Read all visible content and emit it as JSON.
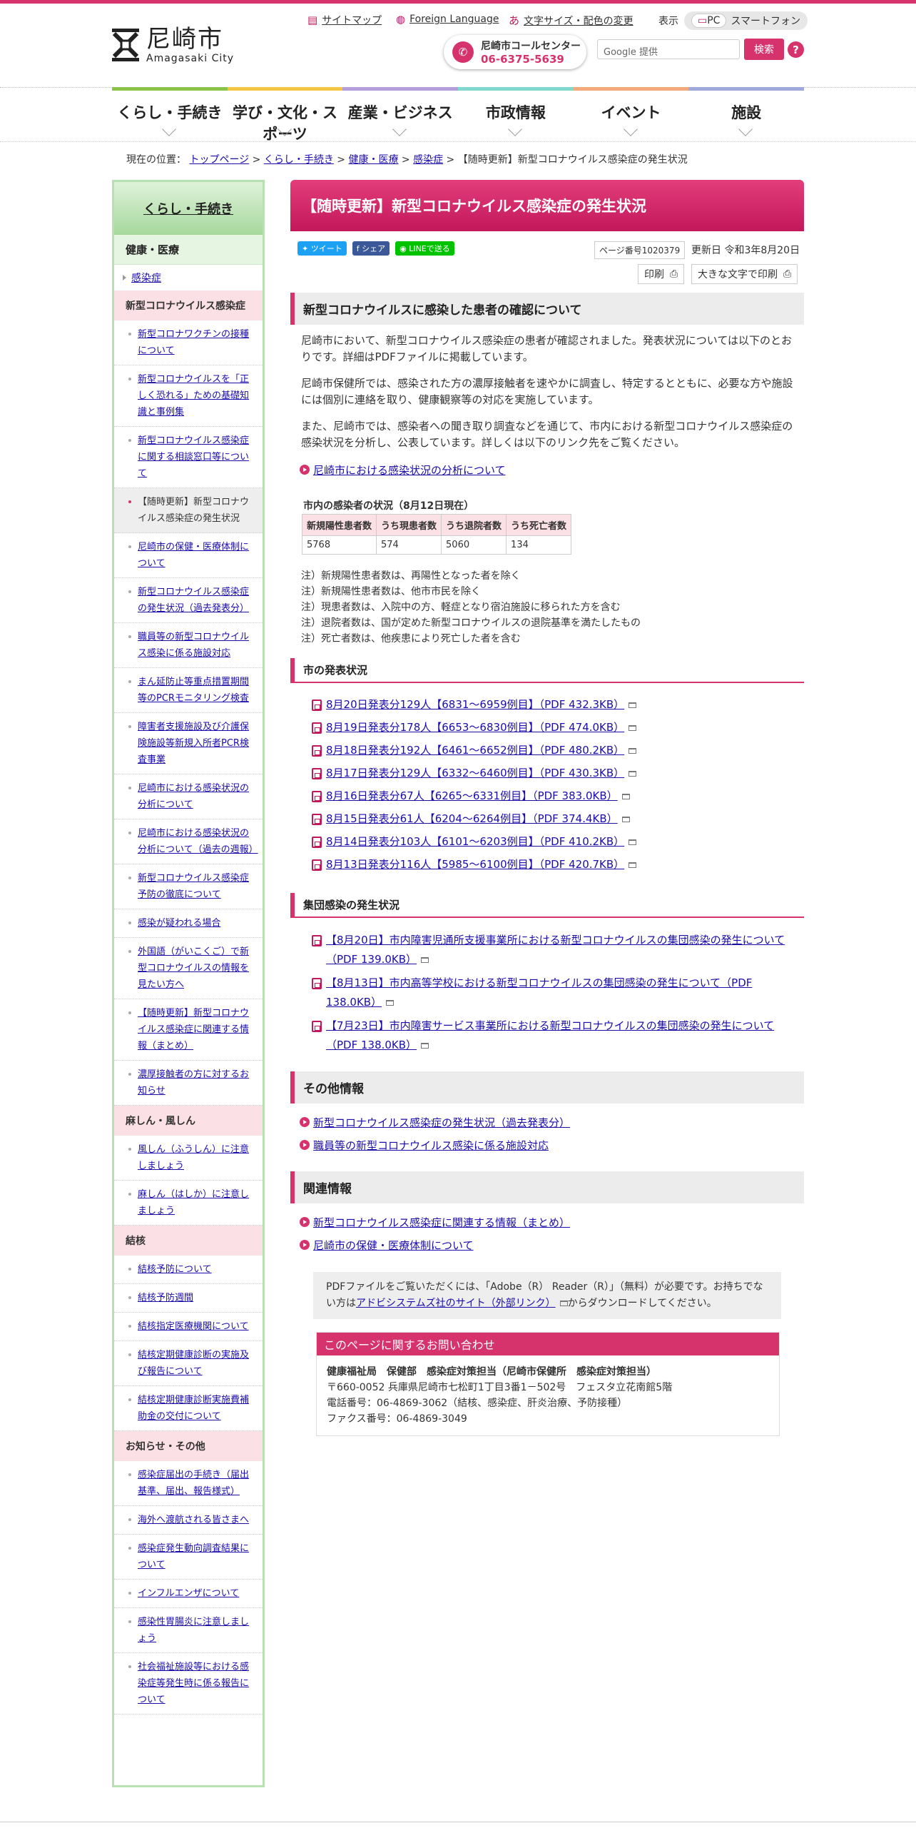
{
  "header": {
    "logo_ja": "尼崎市",
    "logo_en": "Amagasaki City",
    "util_sitemap": "サイトマップ",
    "util_foreign": "Foreign Language",
    "util_textsize": "文字サイズ・配色の変更",
    "display_label": "表示",
    "display_pc": "PC",
    "display_sp": "スマートフォン",
    "call_center_label": "尼崎市コールセンター",
    "call_center_tel": "06-6375-5639",
    "search_placeholder": "Google 提供",
    "search_button": "検索",
    "help": "?"
  },
  "gnav": {
    "items": [
      {
        "label": "くらし・手続き",
        "color": "#8bc34a"
      },
      {
        "label": "学び・文化・スポーツ",
        "color": "#f4c542"
      },
      {
        "label": "産業・ビジネス",
        "color": "#b39ddb"
      },
      {
        "label": "市政情報",
        "color": "#80d8cf"
      },
      {
        "label": "イベント",
        "color": "#f4a97a"
      },
      {
        "label": "施設",
        "color": "#9fa8da"
      }
    ]
  },
  "breadcrumb": {
    "prefix": "現在の位置：",
    "items": [
      "トップページ",
      "くらし・手続き",
      "健康・医療",
      "感染症"
    ],
    "current": "【随時更新】新型コロナウイルス感染症の発生状況"
  },
  "sidebar": {
    "head": "くらし・手続き",
    "sub": "健康・医療",
    "category": "感染症",
    "group1": "新型コロナウイルス感染症",
    "links1": [
      "新型コロナワクチンの接種について",
      "新型コロナウイルスを「正しく恐れる」ための基礎知識と事例集",
      "新型コロナウイルス感染症に関する相談窓口等について",
      "【随時更新】新型コロナウイルス感染症の発生状況",
      "尼崎市の保健・医療体制について",
      "新型コロナウイルス感染症の発生状況（過去発表分）",
      "職員等の新型コロナウイルス感染に係る施設対応",
      "まん延防止等重点措置期間等のPCRモニタリング検査",
      "障害者支援施設及び介護保険施設等新規入所者PCR検査事業",
      "尼崎市における感染状況の分析について",
      "尼崎市における感染状況の分析について（過去の週報）",
      "新型コロナウイルス感染症予防の徹底について",
      "感染が疑われる場合",
      "外国語（がいこくご）で新型コロナウイルスの情報を見たい方へ",
      "【随時更新】新型コロナウイルス感染症に関連する情報（まとめ）",
      "濃厚接触者の方に対するお知らせ"
    ],
    "group2": "麻しん・風しん",
    "links2": [
      "風しん（ふうしん）に注意しましょう",
      "麻しん（はしか）に注意しましょう"
    ],
    "group3": "結核",
    "links3": [
      "結核予防について",
      "結核予防週間",
      "結核指定医療機関について",
      "結核定期健康診断の実施及び報告について",
      "結核定期健康診断実施費補助金の交付について"
    ],
    "group4": "お知らせ・その他",
    "links4": [
      "感染症届出の手続き（届出基準、届出、報告様式）",
      "海外へ渡航される皆さまへ",
      "感染症発生動向調査結果について",
      "インフルエンザについて",
      "感染性胃腸炎に注意しましょう",
      "社会福祉施設等における感染症等発生時に係る報告について"
    ]
  },
  "main": {
    "title": "【随時更新】新型コロナウイルス感染症の発生状況",
    "sns_tweet": "ツイート",
    "sns_share": "シェア",
    "sns_line": "LINEで送る",
    "page_no": "ページ番号1020379",
    "updated": "更新日 令和3年8月20日",
    "print": "印刷",
    "print_large": "大きな文字で印刷",
    "h2_confirm": "新型コロナウイルスに感染した患者の確認について",
    "p1": "尼崎市において、新型コロナウイルス感染症の患者が確認されました。発表状況については以下のとおりです。詳細はPDFファイルに掲載しています。",
    "p2": "尼崎市保健所では、感染された方の濃厚接触者を速やかに調査し、特定するとともに、必要な方や施設には個別に連絡を取り、健康観察等の対応を実施しています。",
    "p3": "また、尼崎市では、感染者への聞き取り調査などを通じて、市内における新型コロナウイルス感染症の感染状況を分析し、公表しています。詳しくは以下のリンク先をご覧ください。",
    "analysis_link": "尼崎市における感染状況の分析について",
    "table_caption": "市内の感染者の状況（8月12日現在）",
    "table_headers": [
      "新規陽性患者数",
      "うち現患者数",
      "うち退院者数",
      "うち死亡者数"
    ],
    "table_values": [
      "5768",
      "574",
      "5060",
      "134"
    ],
    "notes": [
      "注）新規陽性患者数は、再陽性となった者を除く",
      "注）新規陽性患者数は、他市市民を除く",
      "注）現患者数は、入院中の方、軽症となり宿泊施設に移られた方を含む",
      "注）退院者数は、国が定めた新型コロナウイルスの退院基準を満たしたもの",
      "注）死亡者数は、他疾患により死亡した者を含む"
    ],
    "h3_announce": "市の発表状況",
    "announce_links": [
      "8月20日発表分129人【6831～6959例目】（PDF 432.3KB）",
      "8月19日発表分178人【6653～6830例目】（PDF 474.0KB）",
      "8月18日発表分192人【6461～6652例目】（PDF 480.2KB）",
      "8月17日発表分129人【6332～6460例目】（PDF 430.3KB）",
      "8月16日発表分67人【6265～6331例目】（PDF 383.0KB）",
      "8月15日発表分61人【6204～6264例目】（PDF 374.4KB）",
      "8月14日発表分103人【6101～6203例目】（PDF 410.2KB）",
      "8月13日発表分116人【5985～6100例目】（PDF 420.7KB）"
    ],
    "h3_cluster": "集団感染の発生状況",
    "cluster_links": [
      "【8月20日】市内障害児通所支援事業所における新型コロナウイルスの集団感染の発生について（PDF 139.0KB）",
      "【8月13日】市内高等学校における新型コロナウイルスの集団感染の発生について（PDF 138.0KB）",
      "【7月23日】市内障害サービス事業所における新型コロナウイルスの集団感染の発生について（PDF 138.0KB）"
    ],
    "h2_other": "その他情報",
    "other_links": [
      "新型コロナウイルス感染症の発生状況（過去発表分）",
      "職員等の新型コロナウイルス感染に係る施設対応"
    ],
    "h2_related": "関連情報",
    "related_links": [
      "新型コロナウイルス感染症に関連する情報（まとめ）",
      "尼崎市の保健・医療体制について"
    ],
    "adobe_text1": "PDFファイルをご覧いただくには、「Adobe（R） Reader（R）」（無料）が必要です。お持ちでない方は",
    "adobe_link": "アドビシステムズ社のサイト（外部リンク）",
    "adobe_text2": "からダウンロードしてください。",
    "contact_head": "このページに関するお問い合わせ",
    "contact_org": "健康福祉局　保健部　感染症対策担当（尼崎市保健所　感染症対策担当）",
    "contact_addr": "〒660-0052 兵庫県尼崎市七松町1丁目3番1－502号　フェスタ立花南館5階",
    "contact_tel": "電話番号：06-4869-3062（結核、感染症、肝炎治療、予防接種）",
    "contact_fax": "ファクス番号：06-4869-3049"
  }
}
